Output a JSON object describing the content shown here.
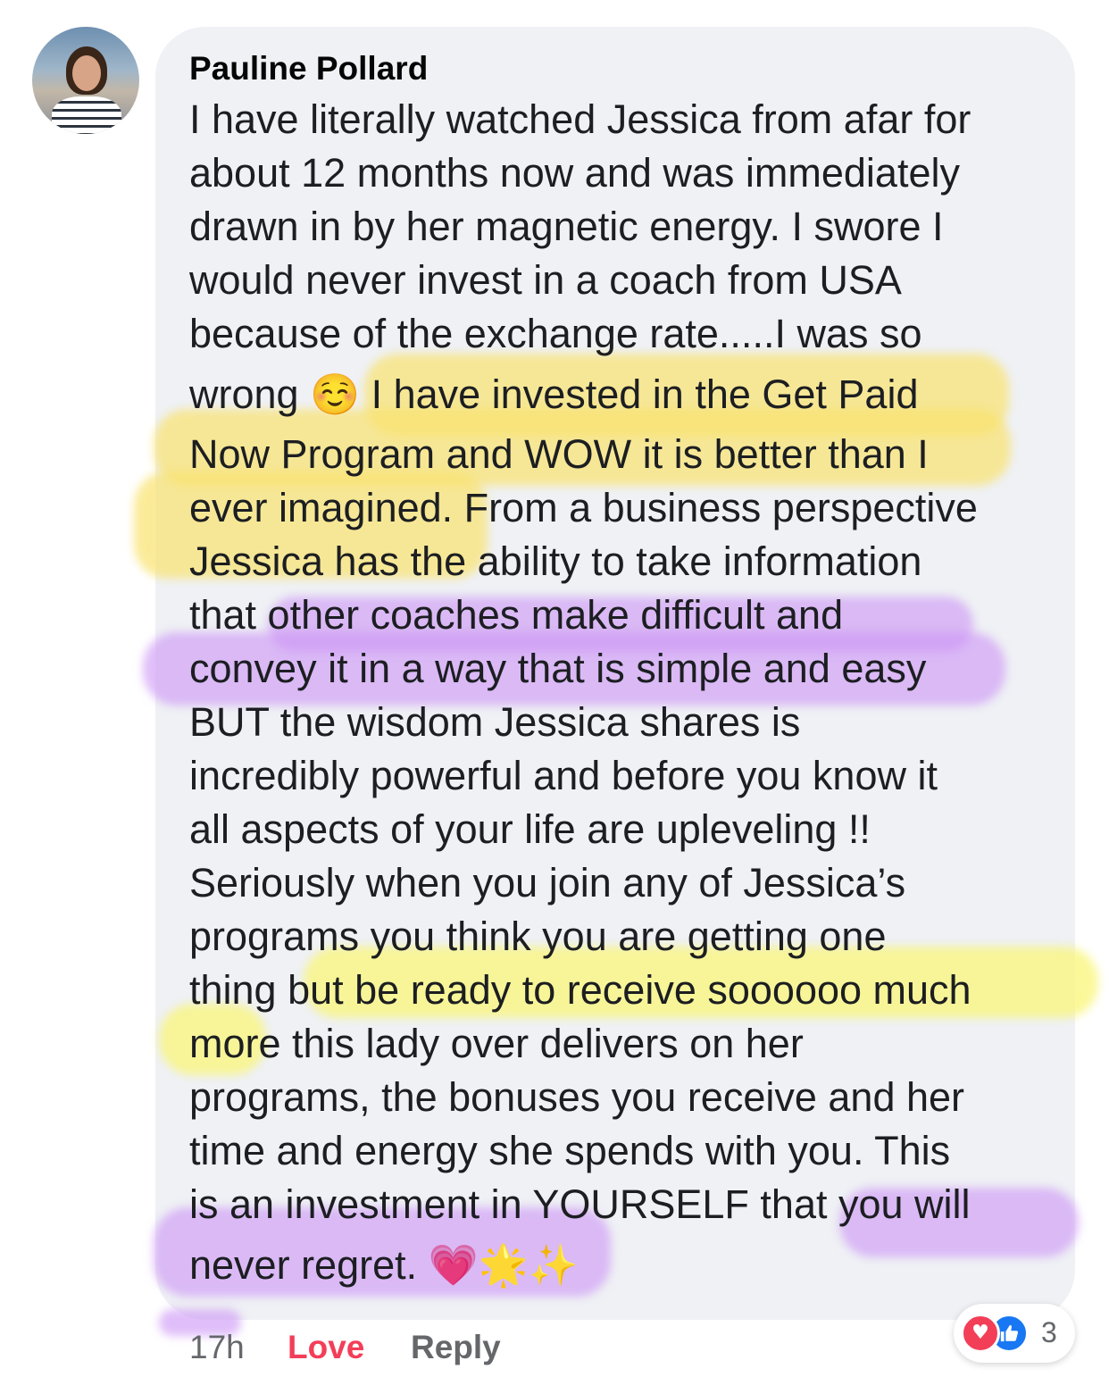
{
  "comment": {
    "author": "Pauline Pollard",
    "lines": [
      "I have literally watched Jessica from afar for",
      "about 12 months now and was immediately",
      "drawn in by her magnetic energy. I swore I",
      "would never invest in a coach from USA",
      "because of the exchange rate.....I was so",
      "wrong ☺️ I have invested in the Get Paid",
      "Now Program and WOW it is better than I",
      "ever imagined. From a business perspective",
      "Jessica has the ability to take information",
      "that other coaches make difficult and",
      "convey it in a way that is simple and easy",
      "BUT  the wisdom Jessica shares is",
      "incredibly powerful and before you know it",
      "all aspects of your life are upleveling !!",
      "Seriously when you join any of Jessica’s",
      "programs you think you are getting one",
      "thing but be ready to receive soooooo much",
      "more this lady over delivers on her",
      "programs, the bonuses you receive and her",
      "time and energy she spends with you. This",
      "is an investment in YOURSELF that you will",
      "never regret. 💗🌟✨"
    ],
    "highlight_colors": {
      "yellow_warm": "#fae26e",
      "yellow_bright": "#faf678",
      "purple": "#cd96f5"
    }
  },
  "footer": {
    "time": "17h",
    "love": "Love",
    "reply": "Reply"
  },
  "reactions": {
    "icons": [
      "heart-icon",
      "like-icon"
    ],
    "count": "3",
    "colors": {
      "heart": "#f33e58",
      "like": "#1877f2"
    }
  }
}
